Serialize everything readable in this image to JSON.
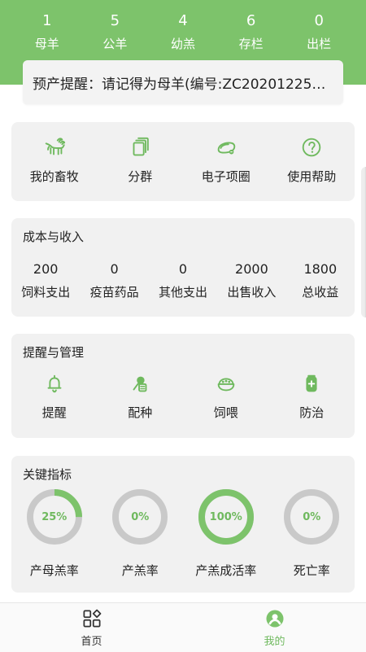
{
  "header": {
    "stats": [
      {
        "value": "1",
        "label": "母羊"
      },
      {
        "value": "5",
        "label": "公羊"
      },
      {
        "value": "4",
        "label": "幼羔"
      },
      {
        "value": "6",
        "label": "存栏"
      },
      {
        "value": "0",
        "label": "出栏"
      }
    ],
    "notice": "预产提醒：请记得为母羊(编号:ZC202012250..."
  },
  "quick_actions": [
    {
      "label": "我的畜牧",
      "icon": "goat-icon"
    },
    {
      "label": "分群",
      "icon": "group-icon"
    },
    {
      "label": "电子项圈",
      "icon": "collar-icon"
    },
    {
      "label": "使用帮助",
      "icon": "help-icon"
    }
  ],
  "cost_income": {
    "title": "成本与收入",
    "items": [
      {
        "value": "200",
        "label": "饲料支出"
      },
      {
        "value": "0",
        "label": "疫苗药品"
      },
      {
        "value": "0",
        "label": "其他支出"
      },
      {
        "value": "2000",
        "label": "出售收入"
      },
      {
        "value": "1800",
        "label": "总收益"
      }
    ]
  },
  "reminders": {
    "title": "提醒与管理",
    "items": [
      {
        "label": "提醒",
        "icon": "bell-icon"
      },
      {
        "label": "配种",
        "icon": "breeding-icon"
      },
      {
        "label": "饲喂",
        "icon": "feed-icon"
      },
      {
        "label": "防治",
        "icon": "medicine-icon"
      }
    ]
  },
  "kpis": {
    "title": "关键指标",
    "items": [
      {
        "value_text": "25%",
        "value": 0.25,
        "label": "产母羔率"
      },
      {
        "value_text": "0%",
        "value": 0.0,
        "label": "产羔率"
      },
      {
        "value_text": "100%",
        "value": 1.0,
        "label": "产羔成活率"
      },
      {
        "value_text": "0%",
        "value": 0.0,
        "label": "死亡率"
      }
    ]
  },
  "bottom_nav": {
    "items": [
      {
        "label": "首页",
        "icon": "home-grid-icon",
        "active": false
      },
      {
        "label": "我的",
        "icon": "profile-icon",
        "active": true
      }
    ]
  },
  "colors": {
    "accent": "#7DC36B",
    "accent_dark": "#6FB95E",
    "ring_track": "#C9C9C9"
  }
}
